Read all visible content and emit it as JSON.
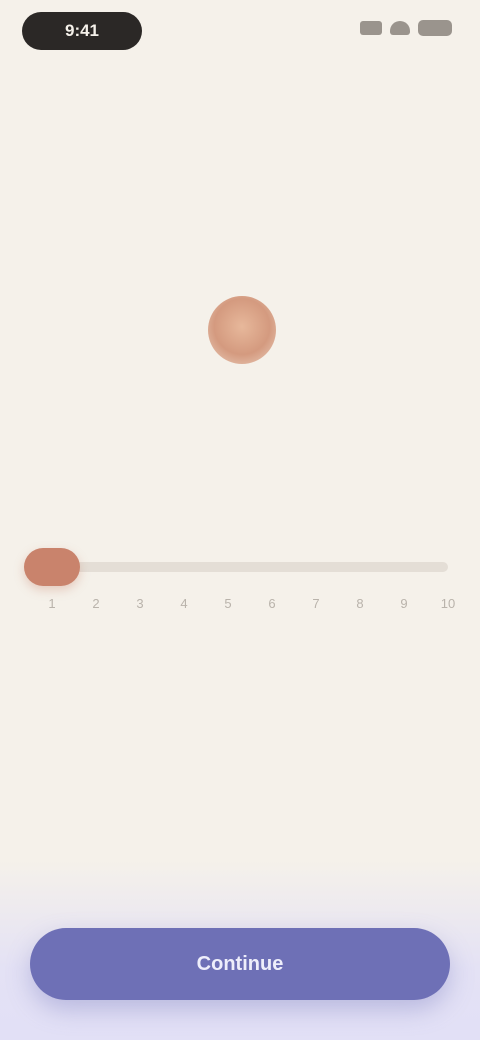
{
  "status_bar": {
    "time": "9:41"
  },
  "header": {
    "title": "",
    "subtitle": ""
  },
  "prompt": {
    "eyebrow": "",
    "question": ""
  },
  "slider": {
    "min": 1,
    "max": 10,
    "value": 1,
    "ticks": [
      "1",
      "2",
      "3",
      "4",
      "5",
      "6",
      "7",
      "8",
      "9",
      "10"
    ]
  },
  "actions": {
    "primary_label": "Continue"
  },
  "colors": {
    "background": "#f5f1ea",
    "accent": "#c9836c",
    "button": "#6e70b6"
  }
}
